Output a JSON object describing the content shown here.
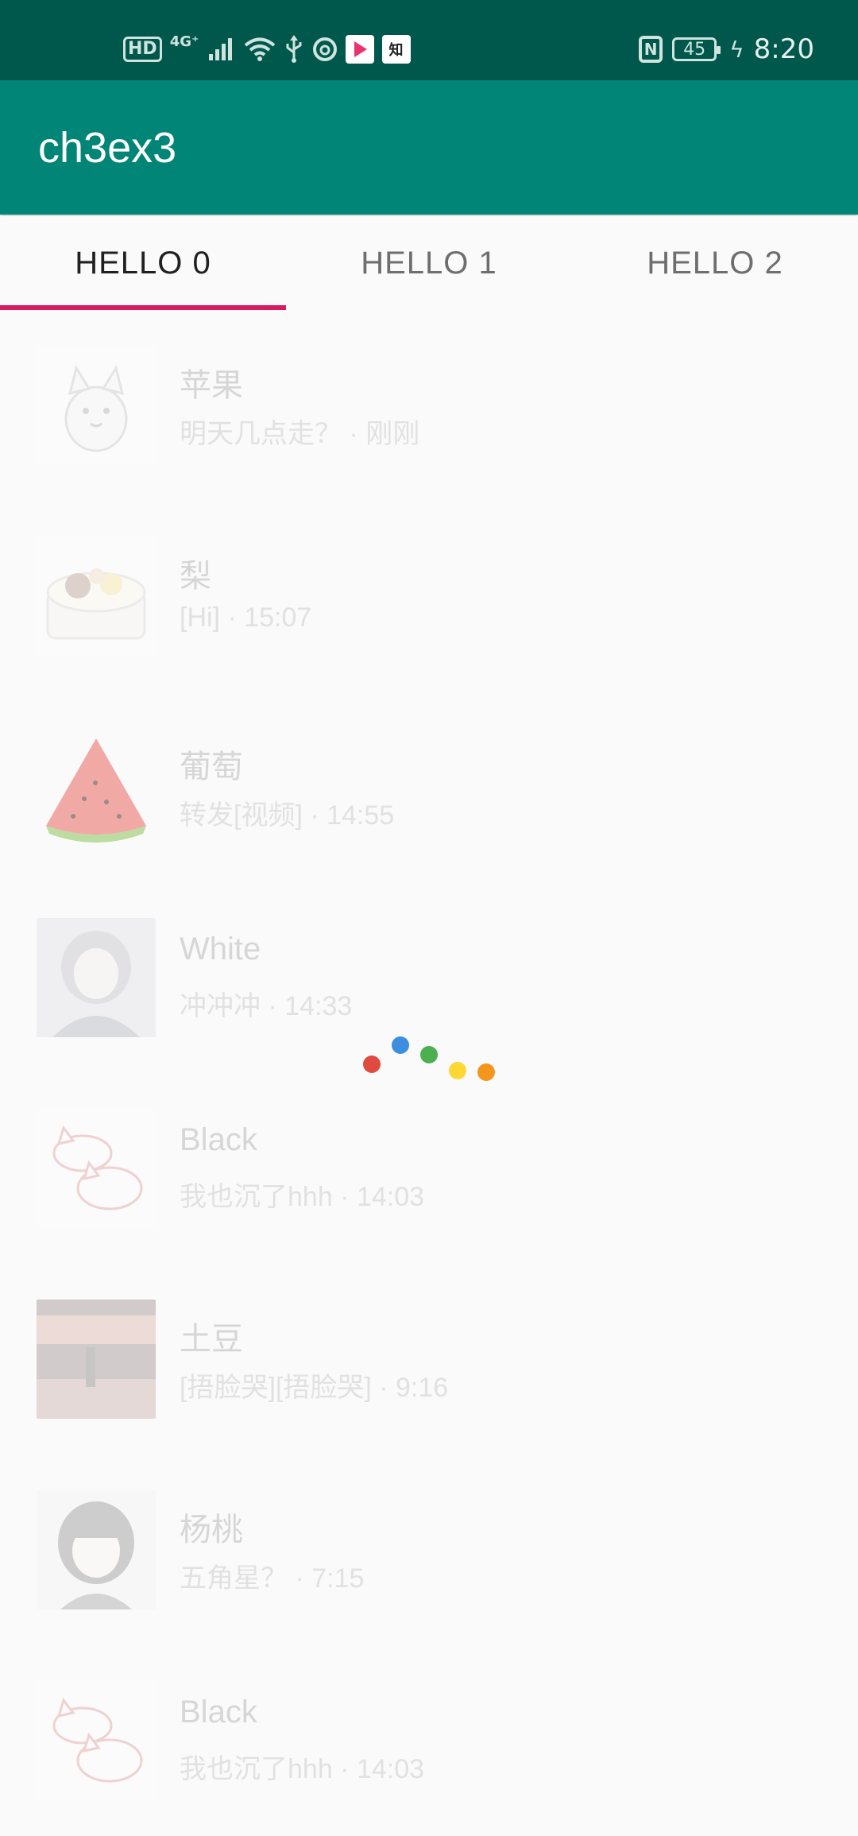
{
  "status_bar": {
    "hd": "HD",
    "signal_label": "4G⁺",
    "battery": "45",
    "time": "8:20",
    "icons": [
      "signal-icon",
      "wifi-icon",
      "usb-icon",
      "netease-icon",
      "youku-icon",
      "zhihu-icon",
      "nfc-icon",
      "battery-icon",
      "charging-icon"
    ]
  },
  "app_bar": {
    "title": "ch3ex3"
  },
  "tabs": [
    {
      "label": "HELLO 0",
      "active": true
    },
    {
      "label": "HELLO 1",
      "active": false
    },
    {
      "label": "HELLO 2",
      "active": false
    }
  ],
  "list": [
    {
      "title": "苹果",
      "subtitle": "明天几点走？ · 刚刚",
      "avatar_icon": "cat-sticker-avatar"
    },
    {
      "title": "梨",
      "subtitle": "[Hi] · 15:07",
      "avatar_icon": "cake-avatar"
    },
    {
      "title": "葡萄",
      "subtitle": "转发[视频] · 14:55",
      "avatar_icon": "watermelon-avatar"
    },
    {
      "title": "White",
      "subtitle": "冲冲冲 · 14:33",
      "avatar_icon": "anime-girl-avatar"
    },
    {
      "title": "Black",
      "subtitle": "我也沉了hhh · 14:03",
      "avatar_icon": "cats-avatar"
    },
    {
      "title": "土豆",
      "subtitle": "[捂脸哭][捂脸哭] · 9:16",
      "avatar_icon": "stage-photo-avatar"
    },
    {
      "title": "杨桃",
      "subtitle": "五角星？ · 7:15",
      "avatar_icon": "manga-girl-avatar"
    },
    {
      "title": "Black",
      "subtitle": "我也沉了hhh · 14:03",
      "avatar_icon": "cats-avatar"
    }
  ],
  "loading": {
    "icon": "loading-dots-icon",
    "colors": [
      "#e04a3f",
      "#3b8ee0",
      "#4caf50",
      "#fdd835",
      "#f5951d"
    ]
  }
}
